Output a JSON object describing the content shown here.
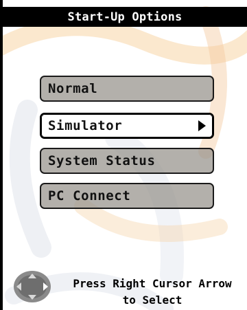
{
  "title": "Start-Up Options",
  "menu": {
    "items": [
      {
        "label": "Normal"
      },
      {
        "label": "Simulator"
      },
      {
        "label": "System Status"
      },
      {
        "label": "PC Connect"
      }
    ]
  },
  "hint": {
    "line1": "Press Right Cursor Arrow",
    "line2": "to Select"
  },
  "colors": {
    "title_bg": "#000000",
    "title_text": "#ffffff",
    "item_fill": "#969189",
    "selected_fill": "#ffffff",
    "watermark": "#f5c98e"
  },
  "icons": {
    "selected_arrow": "right-triangle-icon",
    "cursor_pad": "cursor-pad-icon"
  }
}
